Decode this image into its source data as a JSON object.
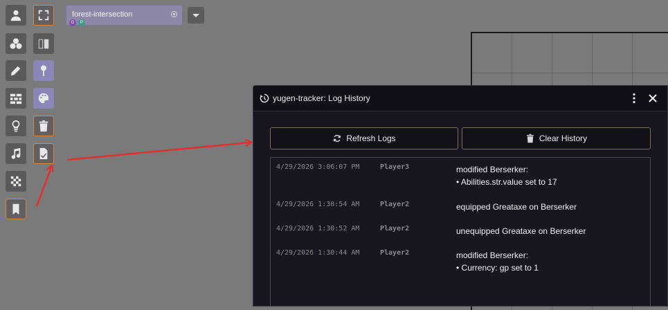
{
  "scene": {
    "name": "forest-intersection",
    "badges": [
      {
        "letter": "G",
        "color": "#7a4fa8"
      },
      {
        "letter": "P",
        "color": "#3f9a8c"
      }
    ]
  },
  "toolbar": {
    "left_column": [
      "user-icon",
      "tokens-icon",
      "pencil-icon",
      "wall-icon",
      "lightbulb-icon",
      "music-icon",
      "checker-icon",
      "bookmark-icon"
    ],
    "right_column": [
      "fullscreen-icon",
      "journal-icon",
      "pin-icon",
      "palette-icon",
      "trash-icon",
      "sheet-icon"
    ]
  },
  "dialog": {
    "title": "yugen-tracker: Log History",
    "refresh_label": "Refresh Logs",
    "clear_label": "Clear History"
  },
  "logs": [
    {
      "time": "4/29/2026 3:06:07 PM",
      "user": "Player3",
      "lines": [
        "modified Berserker:",
        "• Abilities.str.value set to 17"
      ]
    },
    {
      "time": "4/29/2026 1:30:54 AM",
      "user": "Player2",
      "lines": [
        "equipped Greataxe on Berserker"
      ]
    },
    {
      "time": "4/29/2026 1:30:52 AM",
      "user": "Player2",
      "lines": [
        "unequipped Greataxe on Berserker"
      ]
    },
    {
      "time": "4/29/2026 1:30:44 AM",
      "user": "Player2",
      "lines": [
        "modified Berserker:",
        "• Currency: gp set to 1"
      ]
    }
  ],
  "colors": {
    "accent_border": "#d08a4a",
    "annotation_arrow": "#e03030",
    "dialog_bg": "#18171f"
  }
}
